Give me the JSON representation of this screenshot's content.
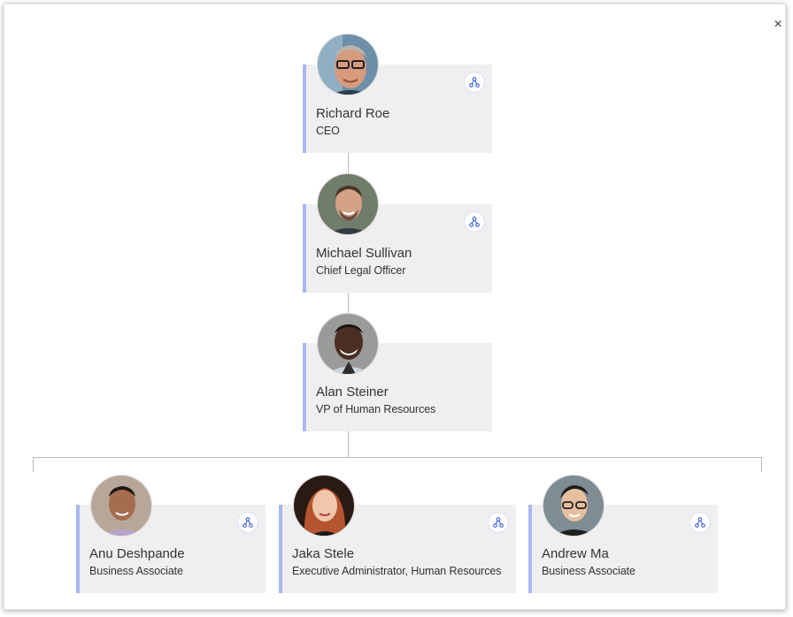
{
  "dialog": {
    "close_label": "×"
  },
  "org": {
    "ceo": {
      "name": "Richard Roe",
      "title": "CEO",
      "avatar": "portrait-man-glasses-gray-hair"
    },
    "clo": {
      "name": "Michael Sullivan",
      "title": "Chief Legal Officer",
      "avatar": "portrait-man-smiling-beard"
    },
    "vp": {
      "name": "Alan Steiner",
      "title": "VP of Human Resources",
      "avatar": "portrait-man-smiling-dark-skin"
    },
    "reports": [
      {
        "name": "Anu Deshpande",
        "title": "Business Associate",
        "avatar": "portrait-man-short-hair"
      },
      {
        "name": "Jaka Stele",
        "title": "Executive Administrator, Human Resources",
        "avatar": "portrait-woman-red-hair"
      },
      {
        "name": "Andrew Ma",
        "title": "Business Associate",
        "avatar": "portrait-man-glasses"
      }
    ]
  },
  "icons": {
    "expand": "org-branch-icon",
    "close": "close-icon"
  },
  "colors": {
    "card_bg": "#efefef",
    "card_accent": "#aab7f2",
    "icon": "#3a5bd9",
    "connector": "#b9b9b9"
  }
}
